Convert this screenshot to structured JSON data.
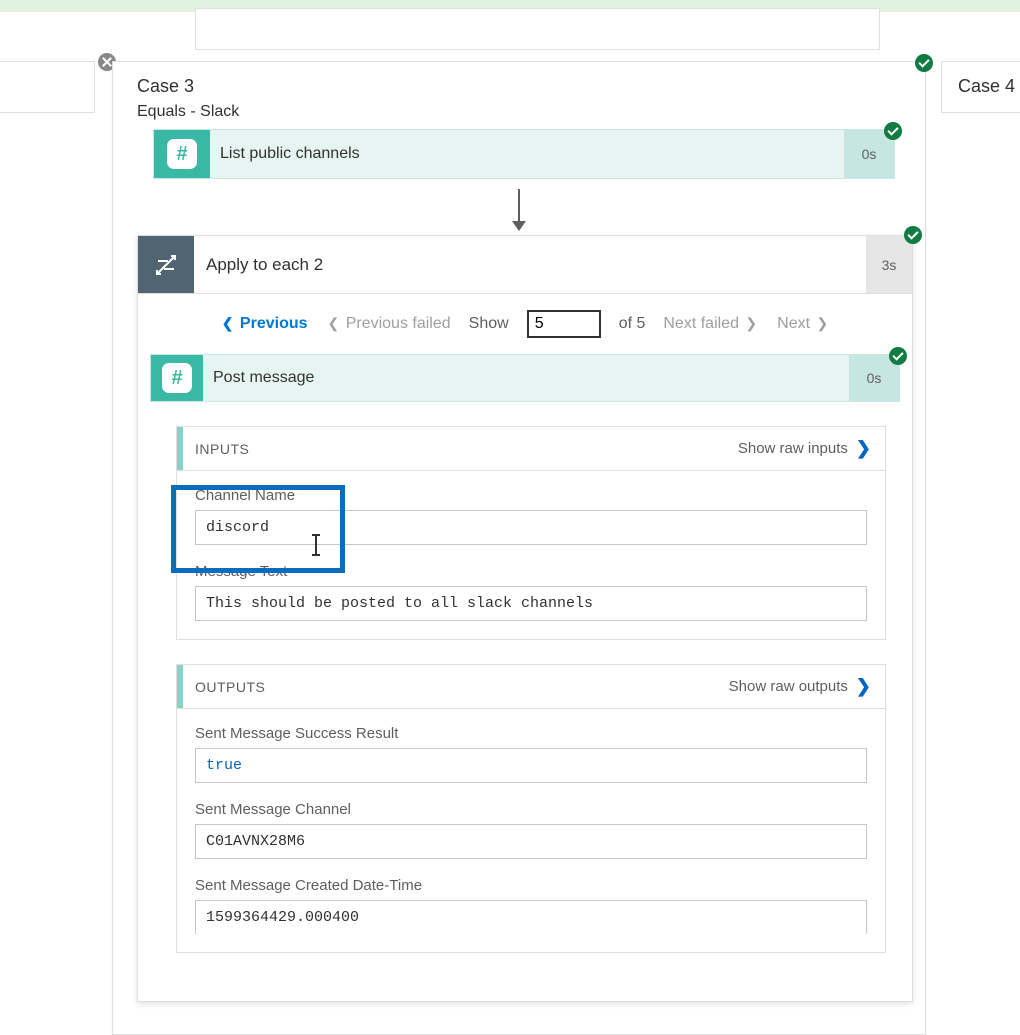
{
  "top": {
    "case3": "Case 3",
    "case4": "Case 4"
  },
  "subtitle": "Equals - Slack",
  "list_channels": {
    "label": "List public channels",
    "duration": "0s"
  },
  "loop": {
    "label": "Apply to each 2",
    "duration": "3s",
    "pager": {
      "previous": "Previous",
      "previous_failed": "Previous failed",
      "show_label": "Show",
      "current": "5",
      "of_total": "of 5",
      "next_failed": "Next failed",
      "next": "Next"
    },
    "post_message": {
      "label": "Post message",
      "duration": "0s"
    }
  },
  "inputs_panel": {
    "title": "INPUTS",
    "rawlink": "Show raw inputs",
    "channel_name_label": "Channel Name",
    "channel_name_value": "discord",
    "message_text_label": "Message Text",
    "message_text_value": "This should be posted to all slack channels"
  },
  "outputs_panel": {
    "title": "OUTPUTS",
    "rawlink": "Show raw outputs",
    "success_label": "Sent Message Success Result",
    "success_value": "true",
    "channel_label": "Sent Message Channel",
    "channel_value": "C01AVNX28M6",
    "created_label": "Sent Message Created Date-Time",
    "created_value": "1599364429.000400"
  }
}
